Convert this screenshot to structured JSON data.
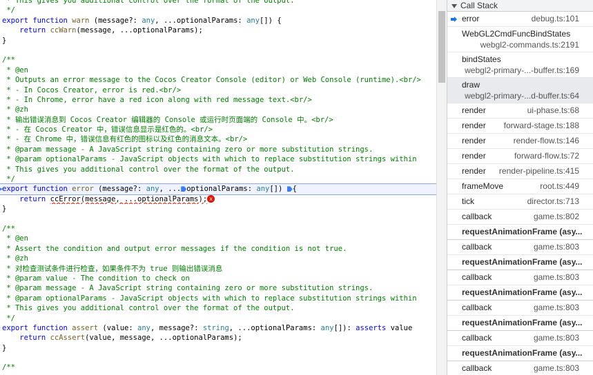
{
  "code_lines": [
    [
      [
        "c",
        " * This gives you additional control over the format of the output."
      ]
    ],
    [
      [
        "c",
        " */"
      ]
    ],
    [
      [
        "k",
        "export"
      ],
      [
        "",
        " "
      ],
      [
        "k",
        "function"
      ],
      [
        "",
        " "
      ],
      [
        "f",
        "warn"
      ],
      [
        "",
        " (message?: "
      ],
      [
        "t",
        "any"
      ],
      [
        "",
        ", ...optionalParams: "
      ],
      [
        "t",
        "any"
      ],
      [
        "",
        "[]) {"
      ]
    ],
    [
      [
        "",
        "    "
      ],
      [
        "k",
        "return"
      ],
      [
        "",
        " "
      ],
      [
        "f",
        "ccWarn"
      ],
      [
        "",
        "(message, ...optionalParams);"
      ]
    ],
    [
      [
        "",
        "}"
      ]
    ],
    [
      [
        "",
        ""
      ]
    ],
    [
      [
        "c",
        "/**"
      ]
    ],
    [
      [
        "c",
        " * @en"
      ]
    ],
    [
      [
        "c",
        " * Outputs an error message to the Cocos Creator Console (editor) or Web Console (runtime).<br/>"
      ]
    ],
    [
      [
        "c",
        " * - In Cocos Creator, error is red.<br/>"
      ]
    ],
    [
      [
        "c",
        " * - In Chrome, error have a red icon along with red message text.<br/>"
      ]
    ],
    [
      [
        "c",
        " * @zh"
      ]
    ],
    [
      [
        "c",
        " * 输出错误消息到 Cocos Creator 编辑器的 Console 或运行时页面端的 Console 中。<br/>"
      ]
    ],
    [
      [
        "c",
        " * - 在 Cocos Creator 中，错误信息显示是红色的。<br/>"
      ]
    ],
    [
      [
        "c",
        " * - 在 Chrome 中，错误信息有红色的图标以及红色的消息文本。<br/>"
      ]
    ],
    [
      [
        "c",
        " * @param message - A JavaScript string containing zero or more substitution strings."
      ]
    ],
    [
      [
        "c",
        " * @param optionalParams - JavaScript objects with which to replace substitution strings within"
      ]
    ],
    [
      [
        "c",
        " * This gives you additional control over the format of the output."
      ]
    ],
    [
      [
        "c",
        " */"
      ]
    ],
    [
      [
        "k",
        "export"
      ],
      [
        "",
        " "
      ],
      [
        "k",
        "function"
      ],
      [
        "",
        " "
      ],
      [
        "f",
        "error"
      ],
      [
        "",
        " (message?: "
      ],
      [
        "t",
        "any"
      ],
      [
        "",
        ", ..."
      ],
      [
        "bp",
        ""
      ],
      [
        "",
        "optionalParams: "
      ],
      [
        "t",
        "any"
      ],
      [
        "",
        "[]) "
      ],
      [
        "bp",
        ""
      ],
      [
        "",
        "{"
      ]
    ],
    [
      [
        "",
        "    "
      ],
      [
        "k",
        "return"
      ],
      [
        "",
        " "
      ],
      [
        "sq",
        "ccError(message, ...optionalParams);"
      ],
      [
        "err",
        "x"
      ]
    ],
    [
      [
        "",
        "}"
      ]
    ],
    [
      [
        "",
        ""
      ]
    ],
    [
      [
        "c",
        "/**"
      ]
    ],
    [
      [
        "c",
        " * @en"
      ]
    ],
    [
      [
        "c",
        " * Assert the condition and output error messages if the condition is not true."
      ]
    ],
    [
      [
        "c",
        " * @zh"
      ]
    ],
    [
      [
        "c",
        " * 对检查测试条件进行检查，如果条件不为 true 则输出错误消息"
      ]
    ],
    [
      [
        "c",
        " * @param value - The condition to check on"
      ]
    ],
    [
      [
        "c",
        " * @param message - A JavaScript string containing zero or more substitution strings."
      ]
    ],
    [
      [
        "c",
        " * @param optionalParams - JavaScript objects with which to replace substitution strings within"
      ]
    ],
    [
      [
        "c",
        " * This gives you additional control over the format of the output."
      ]
    ],
    [
      [
        "c",
        " */"
      ]
    ],
    [
      [
        "k",
        "export"
      ],
      [
        "",
        " "
      ],
      [
        "k",
        "function"
      ],
      [
        "",
        " "
      ],
      [
        "f",
        "assert"
      ],
      [
        "",
        " (value: "
      ],
      [
        "t",
        "any"
      ],
      [
        "",
        ", message?: "
      ],
      [
        "t",
        "string"
      ],
      [
        "",
        ", ...optionalParams: "
      ],
      [
        "t",
        "any"
      ],
      [
        "",
        "[]): "
      ],
      [
        "k",
        "asserts"
      ],
      [
        "",
        " value"
      ]
    ],
    [
      [
        "",
        "    "
      ],
      [
        "k",
        "return"
      ],
      [
        "",
        " "
      ],
      [
        "f",
        "ccAssert"
      ],
      [
        "",
        "(value, message, ...optionalParams);"
      ]
    ],
    [
      [
        "",
        "}"
      ]
    ],
    [
      [
        "",
        ""
      ]
    ],
    [
      [
        "c",
        "/**"
      ]
    ]
  ],
  "highlight_line": 19,
  "call_stack": {
    "title": "Call Stack",
    "frames": [
      {
        "fn": "error",
        "loc": "debug.ts:101",
        "layout": "single",
        "current": true
      },
      {
        "fn": "WebGL2CmdFuncBindStates",
        "loc": "webgl2-commands.ts:2191",
        "layout": "double"
      },
      {
        "fn": "bindStates",
        "loc": "webgl2-primary-...-buffer.ts:169",
        "layout": "double"
      },
      {
        "fn": "draw",
        "loc": "webgl2-primary-...d-buffer.ts:64",
        "layout": "double",
        "selected": true
      },
      {
        "fn": "render",
        "loc": "ui-phase.ts:68",
        "layout": "single"
      },
      {
        "fn": "render",
        "loc": "forward-stage.ts:188",
        "layout": "single"
      },
      {
        "fn": "render",
        "loc": "render-flow.ts:146",
        "layout": "single"
      },
      {
        "fn": "render",
        "loc": "forward-flow.ts:72",
        "layout": "single"
      },
      {
        "fn": "render",
        "loc": "render-pipeline.ts:415",
        "layout": "single"
      },
      {
        "fn": "frameMove",
        "loc": "root.ts:449",
        "layout": "single"
      },
      {
        "fn": "tick",
        "loc": "director.ts:713",
        "layout": "single"
      },
      {
        "fn": "callback",
        "loc": "game.ts:802",
        "layout": "single"
      },
      {
        "async": "requestAnimationFrame (asy..."
      },
      {
        "fn": "callback",
        "loc": "game.ts:803",
        "layout": "single"
      },
      {
        "async": "requestAnimationFrame (asy..."
      },
      {
        "fn": "callback",
        "loc": "game.ts:803",
        "layout": "single"
      },
      {
        "async": "requestAnimationFrame (asy..."
      },
      {
        "fn": "callback",
        "loc": "game.ts:803",
        "layout": "single"
      },
      {
        "async": "requestAnimationFrame (asy..."
      },
      {
        "fn": "callback",
        "loc": "game.ts:803",
        "layout": "single"
      },
      {
        "async": "requestAnimationFrame (asy..."
      },
      {
        "fn": "callback",
        "loc": "game.ts:803",
        "layout": "single"
      }
    ]
  }
}
